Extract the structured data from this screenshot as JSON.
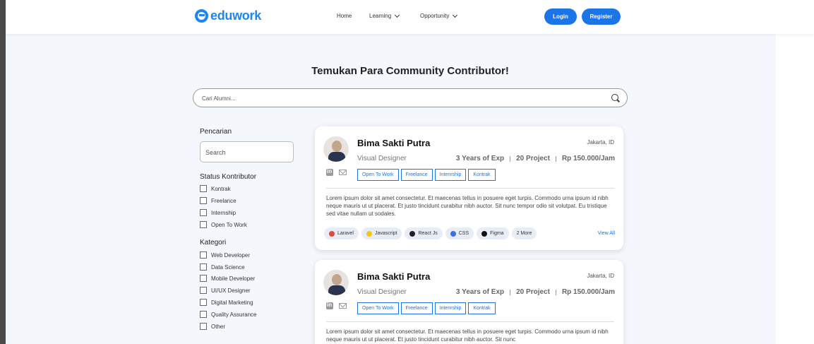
{
  "header": {
    "logo_text": "eduwork",
    "nav": [
      "Home",
      "Learning",
      "Opportunity"
    ],
    "login_label": "Login",
    "register_label": "Register"
  },
  "page": {
    "title": "Temukan Para Community Contributor!",
    "search_placeholder": "Cari Alumni..."
  },
  "sidebar": {
    "search_heading": "Pencarian",
    "search_placeholder": "Search",
    "status_heading": "Status Kontributor",
    "status_options": [
      "Kontrak",
      "Freelance",
      "Internship",
      "Open To Work"
    ],
    "category_heading": "Kategori",
    "category_options": [
      "Web Developer",
      "Data Science",
      "Mobile Developer",
      "UI/UX Designer",
      "Digital Marketing",
      "Quality Assurance",
      "Other"
    ]
  },
  "cards": [
    {
      "name": "Bima Sakti Putra",
      "location": "Jakarta, ID",
      "role": "Visual Designer",
      "experience": "3 Years of Exp",
      "projects": "20 Project",
      "rate": "Rp 150.000/Jam",
      "tags": [
        "Open To Work",
        "Freelance",
        "Intenrship",
        "Kontrak"
      ],
      "description": "Lorem ipsum dolor sit amet consectetur. Et maecenas tellus in posuere eget turpis. Commodo urna ipsum id nibh neque mauris ut ut placerat. Et justo tincidunt curabitur nibh auctor. Sit nunc tempor odio sit volutpat. Eu tristique sed vitae nullam ut sodales.",
      "skills": [
        "Laravel",
        "Javascript",
        "React Js",
        "CSS",
        "Figma",
        "2 More"
      ],
      "view_all": "View All"
    },
    {
      "name": "Bima Sakti Putra",
      "location": "Jakarta, ID",
      "role": "Visual Designer",
      "experience": "3 Years of Exp",
      "projects": "20 Project",
      "rate": "Rp 150.000/Jam",
      "tags": [
        "Open To Work",
        "Freelance",
        "Intenrship",
        "Kontrak"
      ],
      "description": "Lorem ipsum dolor sit amet consectetur. Et maecenas tellus in posuere eget turpis. Commodo urna ipsum id nibh neque mauris ut ut placerat. Et justo tincidunt curabitur nibh auctor. Sit nunc"
    }
  ],
  "colors": {
    "primary": "#1b74e8",
    "background": "#f4f8fc"
  },
  "skill_colors": [
    "#e04a3c",
    "#f5c518",
    "#222222",
    "#3b6ee8",
    "#111111",
    ""
  ]
}
